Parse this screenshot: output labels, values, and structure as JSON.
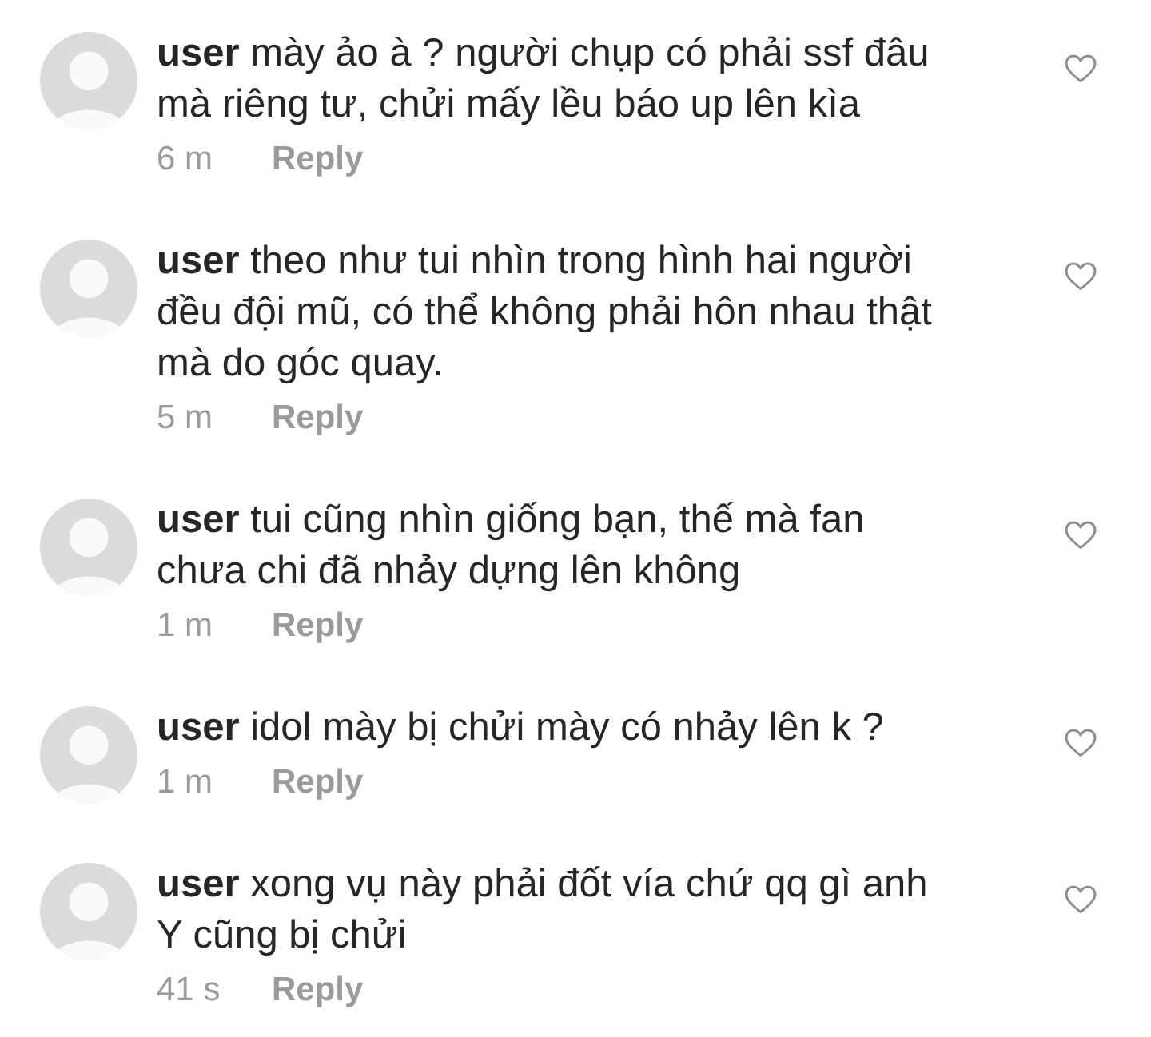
{
  "comments": [
    {
      "username": "user",
      "text": "mày ảo à ? người chụp có phải ssf đâu mà riêng tư, chửi mấy lều báo up lên kìa",
      "time": "6 m",
      "reply": "Reply",
      "liked": false
    },
    {
      "username": "user",
      "text": "theo như tui nhìn trong hình hai người đều đội mũ, có thể không phải hôn nhau thật mà do góc quay.",
      "time": "5 m",
      "reply": "Reply",
      "liked": false
    },
    {
      "username": "user",
      "text": "tui cũng nhìn giống bạn, thế mà fan chưa chi đã nhảy dựng lên không",
      "time": "1 m",
      "reply": "Reply",
      "liked": false
    },
    {
      "username": "user",
      "text": "idol mày bị chửi mày có nhảy lên k ?",
      "time": "1 m",
      "reply": "Reply",
      "liked": false
    },
    {
      "username": "user",
      "text": "xong vụ này phải đốt vía chứ qq gì anh Y cũng bị chửi",
      "time": "41 s",
      "reply": "Reply",
      "liked": false
    }
  ]
}
